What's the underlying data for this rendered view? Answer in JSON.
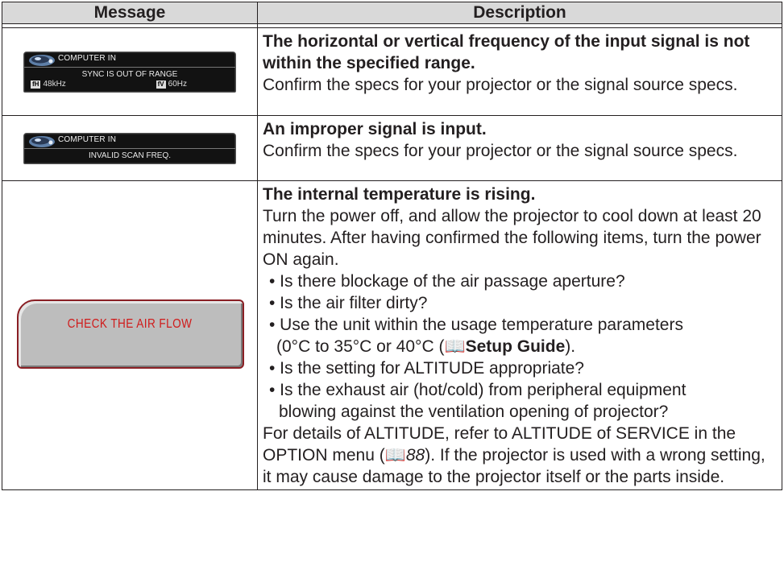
{
  "table": {
    "header_message": "Message",
    "header_description": "Description"
  },
  "rows": [
    {
      "osd": {
        "title": "COMPUTER IN",
        "line1": "SYNC IS OUT OF RANGE",
        "fh_label": "fH",
        "fh_value": "48kHz",
        "fv_label": "fV",
        "fv_value": "60Hz"
      },
      "desc_head": "The horizontal or vertical frequency of the input signal is not within the specified range.",
      "desc_body": "Confirm the specs for your projector or the signal source specs."
    },
    {
      "osd": {
        "title": "COMPUTER IN",
        "line1": "INVALID SCAN FREQ."
      },
      "desc_head": "An improper signal is input.",
      "desc_body": "Confirm the specs for your projector or the signal source specs."
    },
    {
      "osd": {
        "text": "CHECK THE AIR FLOW"
      },
      "desc_head": "The internal temperature is rising.",
      "desc_body": "Turn the power off, and allow the projector to cool down at least 20 minutes. After having confirmed the following items, turn the power ON again.",
      "bullets": [
        "• Is there blockage of the air passage aperture?",
        "• Is the air filter dirty?",
        "• Use the unit within the usage temperature parameters"
      ],
      "temp_range": "(0°C to 35°C or 40°C (",
      "setup_guide": "Setup Guide",
      "temp_close": ").",
      "bullets2": [
        "• Is the setting for ALTITUDE appropriate?",
        "• Is the exhaust air (hot/cold) from peripheral equipment"
      ],
      "bullet_cont": "blowing against the ventilation opening of projector?",
      "details_1": "For details of ALTITUDE, refer to ALTITUDE of SERVICE in the OPTION menu (",
      "page_ref": "88",
      "details_2": "). If the projector is used with a wrong setting, it may cause damage to the projector itself or the parts inside."
    }
  ]
}
